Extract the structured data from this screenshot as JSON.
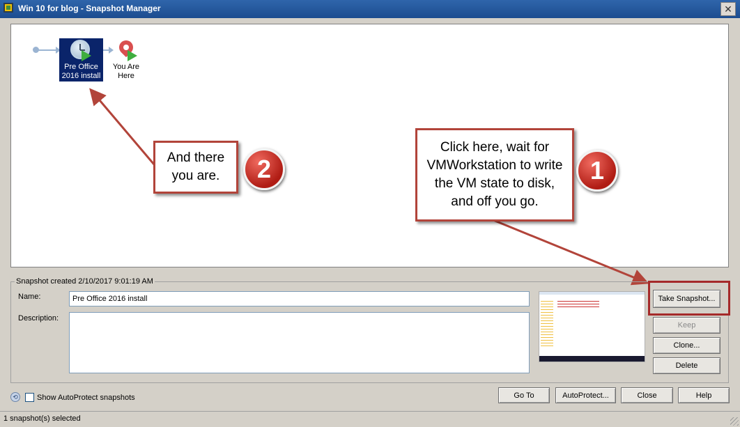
{
  "window": {
    "title": "Win 10 for blog - Snapshot Manager",
    "close_glyph": "✕"
  },
  "tree": {
    "snapshot_label_line1": "Pre Office",
    "snapshot_label_line2": "2016 install",
    "current_label_line1": "You Are",
    "current_label_line2": "Here"
  },
  "annotations": {
    "callout_2": [
      "And there",
      "you are."
    ],
    "callout_1": [
      "Click here, wait for",
      "VMWorkstation to write",
      "the VM state to disk,",
      "and off you go."
    ],
    "badge_1": "1",
    "badge_2": "2",
    "color_red": "#b2443a"
  },
  "details": {
    "group_title": "Snapshot created 2/10/2017 9:01:19 AM",
    "name_label": "Name:",
    "name_value": "Pre Office 2016 install",
    "description_label": "Description:",
    "description_value": ""
  },
  "buttons": {
    "take_snapshot": "Take Snapshot...",
    "keep": "Keep",
    "clone": "Clone...",
    "delete": "Delete",
    "go_to": "Go To",
    "autoprotect": "AutoProtect...",
    "close": "Close",
    "help": "Help"
  },
  "footer": {
    "show_autoprotect_label": "Show AutoProtect snapshots",
    "show_autoprotect_checked": false
  },
  "status": {
    "text": "1 snapshot(s) selected"
  }
}
